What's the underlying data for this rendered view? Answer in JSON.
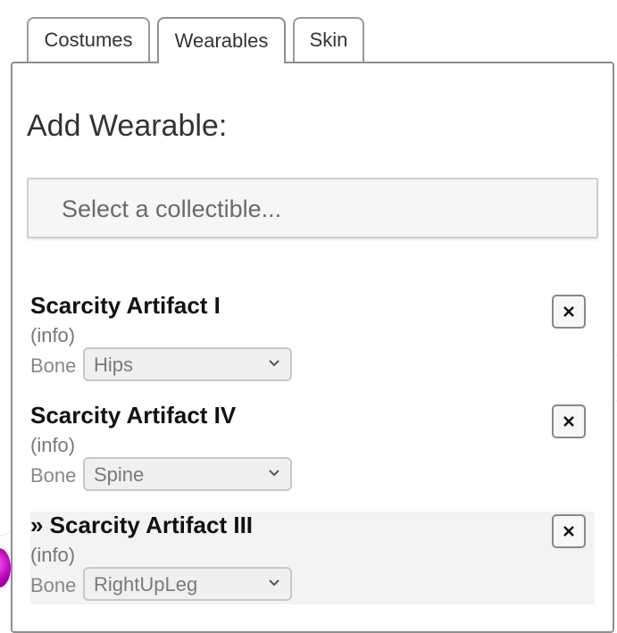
{
  "tabs": [
    {
      "label": "Costumes",
      "active": false
    },
    {
      "label": "Wearables",
      "active": true
    },
    {
      "label": "Skin",
      "active": false
    }
  ],
  "panel": {
    "title": "Add Wearable:",
    "collectible_select": {
      "placeholder": "Select a collectible..."
    }
  },
  "wearables": [
    {
      "name": "Scarcity Artifact I",
      "info": "(info)",
      "bone_label": "Bone",
      "bone": "Hips",
      "remove_icon": "close-icon",
      "current": false
    },
    {
      "name": "Scarcity Artifact IV",
      "info": "(info)",
      "bone_label": "Bone",
      "bone": "Spine",
      "remove_icon": "close-icon",
      "current": false
    },
    {
      "name": "» Scarcity Artifact III",
      "info": "(info)",
      "bone_label": "Bone",
      "bone": "RightUpLeg",
      "remove_icon": "close-icon",
      "current": true
    }
  ],
  "colors": {
    "border": "#8f8f8f",
    "current_row": "#f2f3f5",
    "sphere": "#c000c0"
  }
}
